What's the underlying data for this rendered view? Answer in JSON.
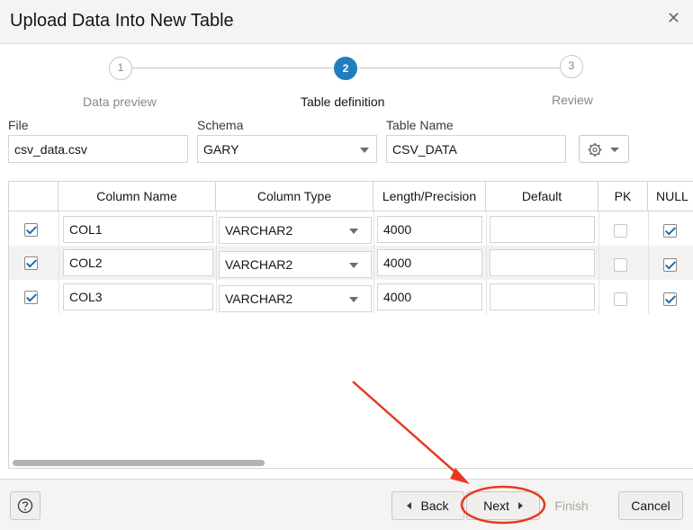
{
  "dialog": {
    "title": "Upload Data Into New Table"
  },
  "stepper": {
    "steps": [
      {
        "number": "1",
        "label": "Data preview"
      },
      {
        "number": "2",
        "label": "Table definition"
      },
      {
        "number": "3",
        "label": "Review"
      }
    ],
    "active_step": 2
  },
  "form": {
    "file_label": "File",
    "file_value": "csv_data.csv",
    "schema_label": "Schema",
    "schema_value": "GARY",
    "table_name_label": "Table Name",
    "table_name_value": "CSV_DATA"
  },
  "grid": {
    "headers": [
      "Column Name",
      "Column Type",
      "Length/Precision",
      "Default",
      "PK",
      "NULL"
    ],
    "rows": [
      {
        "selected": true,
        "name": "COL1",
        "type": "VARCHAR2",
        "length": "4000",
        "default": "",
        "pk": false,
        "nullable": true
      },
      {
        "selected": true,
        "name": "COL2",
        "type": "VARCHAR2",
        "length": "4000",
        "default": "",
        "pk": false,
        "nullable": true
      },
      {
        "selected": true,
        "name": "COL3",
        "type": "VARCHAR2",
        "length": "4000",
        "default": "",
        "pk": false,
        "nullable": true
      }
    ]
  },
  "footer": {
    "back_label": "Back",
    "next_label": "Next",
    "finish_label": "Finish",
    "cancel_label": "Cancel"
  },
  "colors": {
    "accent": "#227dbd",
    "annotation": "#e8391f",
    "checkbox": "#1a6fb0"
  },
  "icons": {
    "close": "close-icon",
    "help": "help-icon",
    "settings": "gear-icon"
  }
}
